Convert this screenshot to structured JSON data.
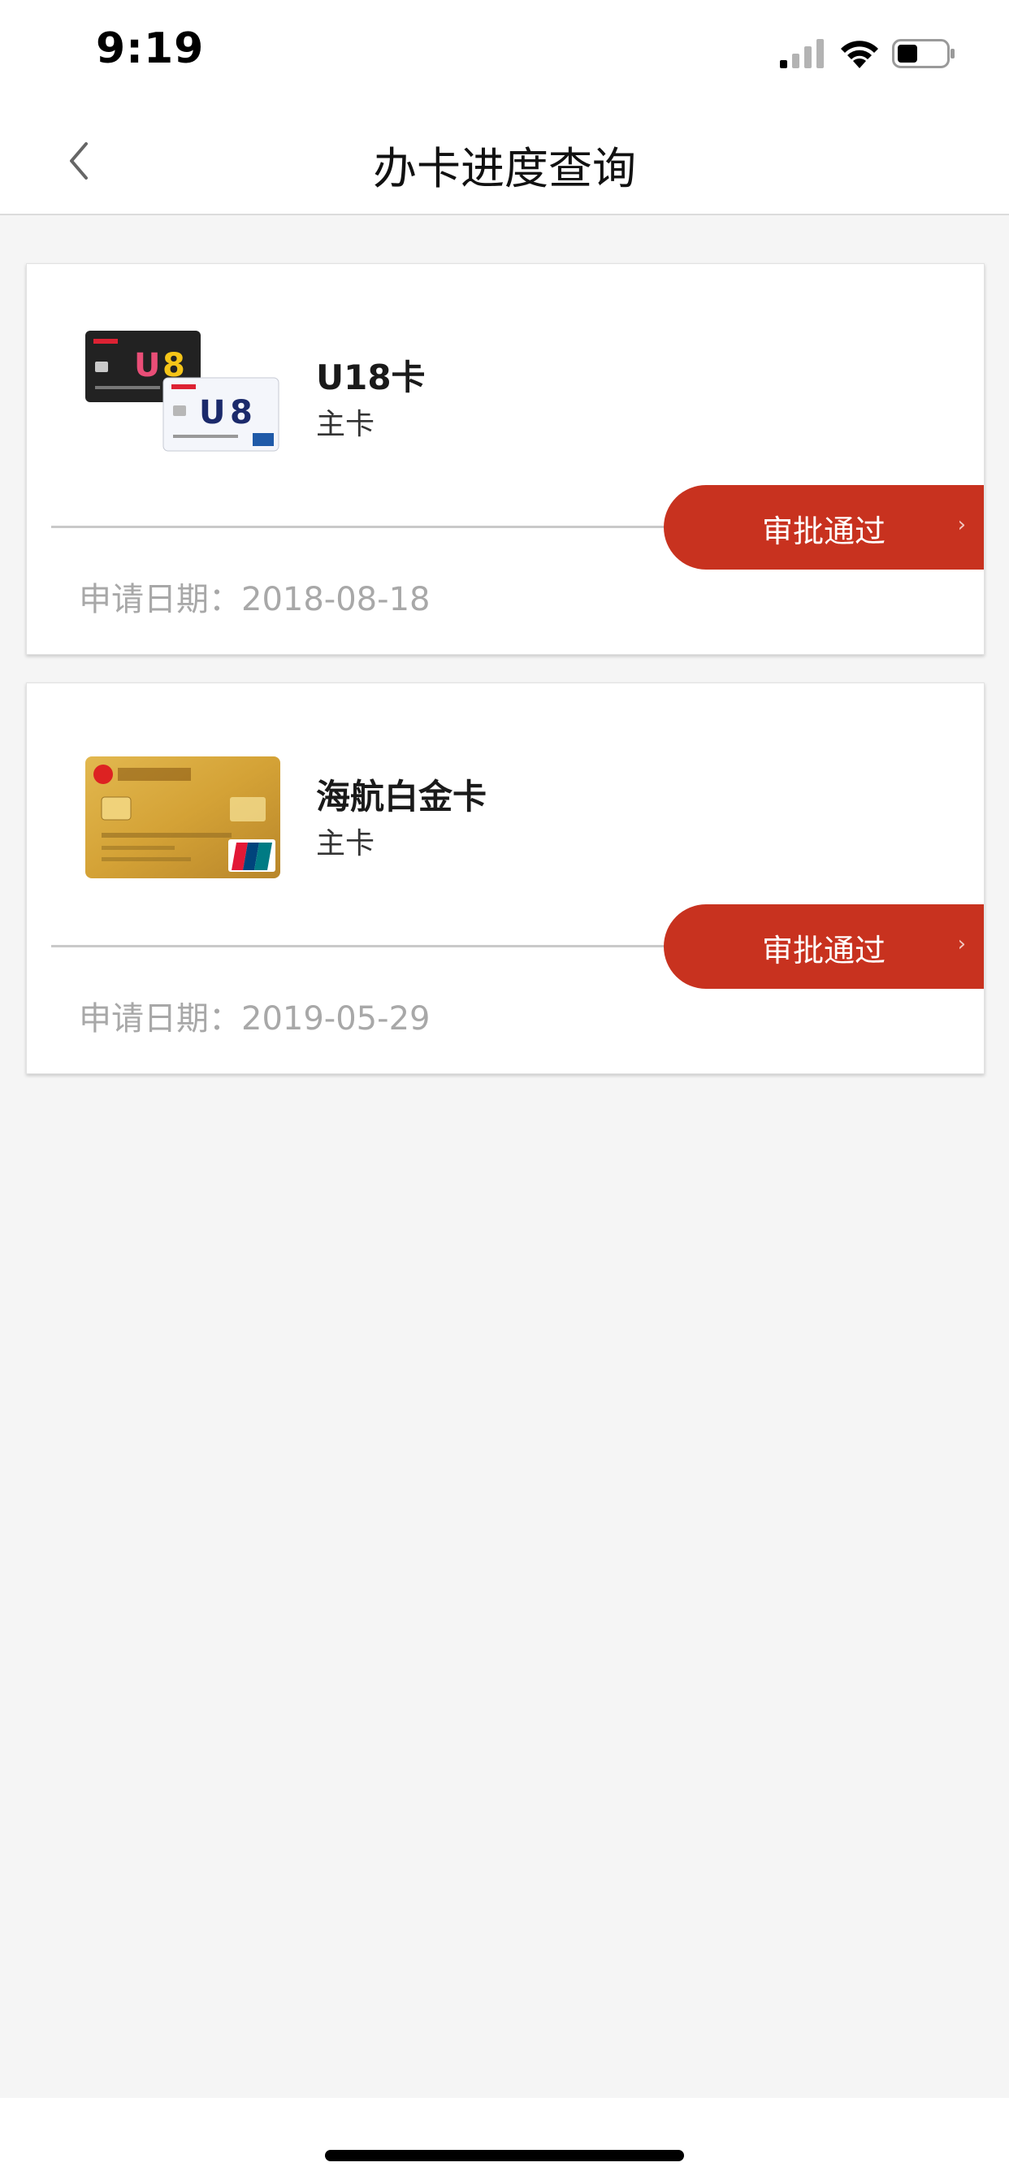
{
  "status_bar": {
    "time": "9:19"
  },
  "nav": {
    "title": "办卡进度查询"
  },
  "cards": [
    {
      "name": "U18卡",
      "type": "主卡",
      "status": "审批通过",
      "date_label": "申请日期：",
      "date": "2018-08-18"
    },
    {
      "name": "海航白金卡",
      "type": "主卡",
      "status": "审批通过",
      "date_label": "申请日期：",
      "date": "2019-05-29"
    }
  ],
  "colors": {
    "accent": "#c8321f",
    "background": "#f5f5f5",
    "card": "#ffffff",
    "muted_text": "#a8a8a8"
  },
  "icons": [
    "back-icon",
    "signal-icon",
    "wifi-icon",
    "battery-icon",
    "chevron-right-icon"
  ]
}
